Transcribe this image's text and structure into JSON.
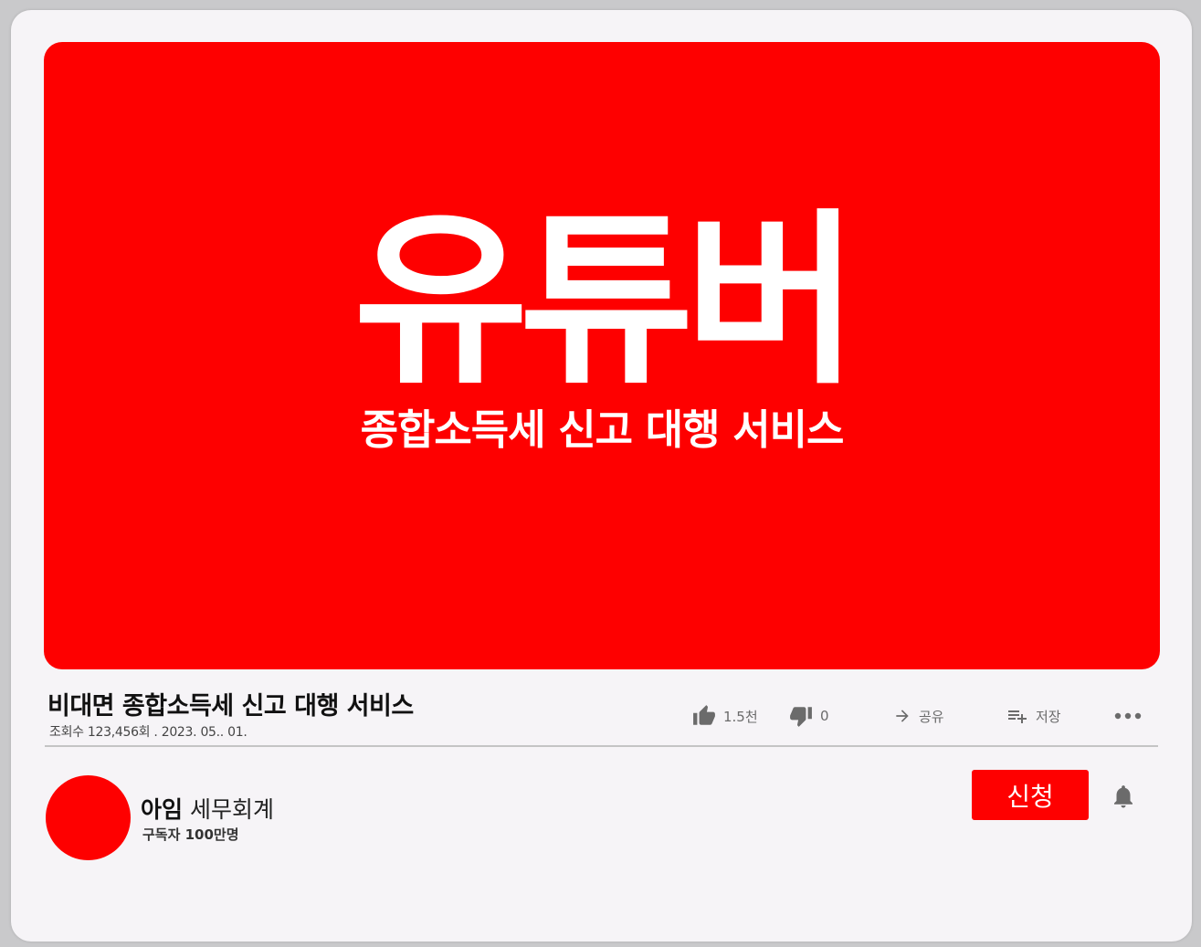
{
  "hero": {
    "title": "유튜버",
    "subtitle": "종합소득세 신고 대행 서비스",
    "background_color": "#fe0000"
  },
  "video": {
    "title": "비대면 종합소득세 신고 대행 서비스",
    "meta": "조회수 123,456회 . 2023. 05.. 01."
  },
  "actions": {
    "like_icon": "thumbs-up-icon",
    "like_count": "1.5천",
    "dislike_icon": "thumbs-down-icon",
    "dislike_count": "0",
    "share_icon": "share-arrow-icon",
    "share_label": "공유",
    "save_icon": "playlist-add-icon",
    "save_label": "저장",
    "more_icon": "more-horizontal-icon"
  },
  "channel": {
    "name_bold": "아임",
    "name_rest": "세무회계",
    "subscribers": "구독자 100만명",
    "avatar_color": "#fe0000"
  },
  "subscribe": {
    "label": "신청",
    "color": "#fe0000"
  },
  "notification_icon": "bell-icon"
}
